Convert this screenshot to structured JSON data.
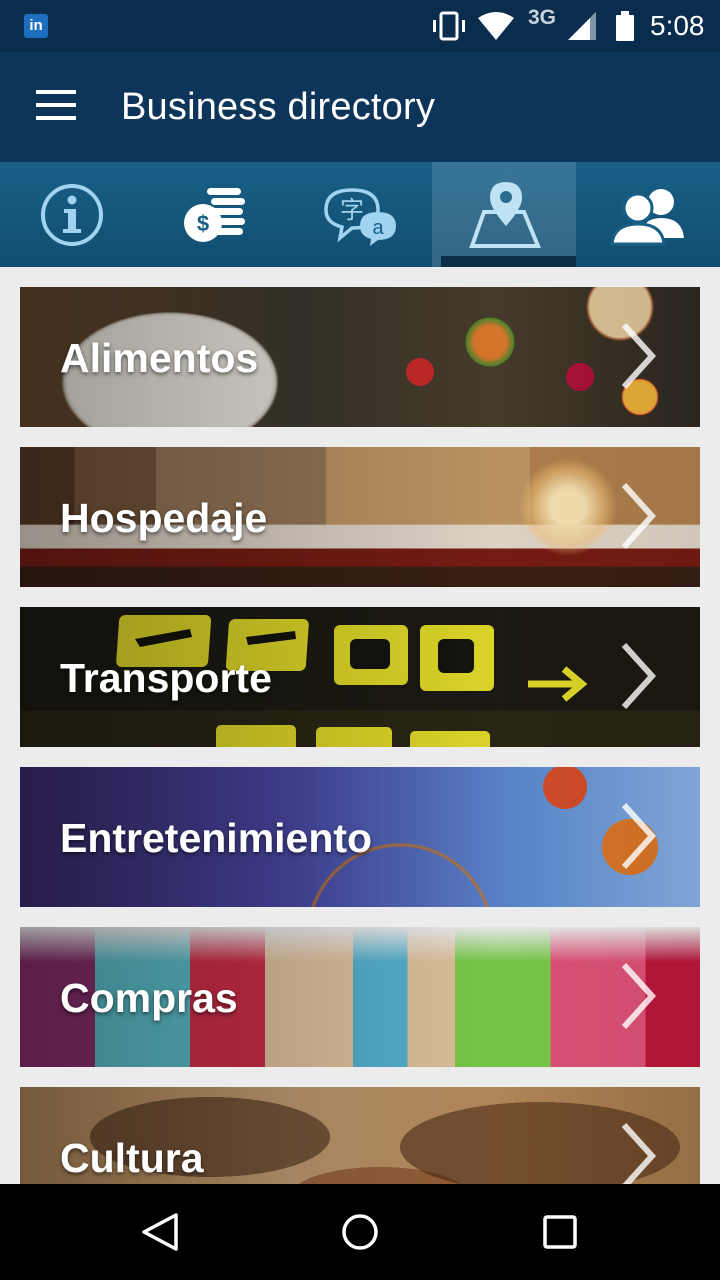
{
  "status_bar": {
    "app_badge": "in",
    "network": "3G",
    "time": "5:08",
    "icons": [
      "linkedin-icon",
      "vibrate-icon",
      "wifi-icon",
      "signal-icon",
      "battery-icon"
    ]
  },
  "app_bar": {
    "title": "Business directory",
    "menu_icon": "hamburger-menu-icon"
  },
  "tabs": [
    {
      "icon": "info-icon",
      "active": false
    },
    {
      "icon": "currency-coins-icon",
      "active": false
    },
    {
      "icon": "translate-icon",
      "active": false
    },
    {
      "icon": "map-pin-icon",
      "active": true
    },
    {
      "icon": "people-icon",
      "active": false
    }
  ],
  "categories": [
    {
      "label": "Alimentos",
      "icon": "chevron-right-icon"
    },
    {
      "label": "Hospedaje",
      "icon": "chevron-right-icon"
    },
    {
      "label": "Transporte",
      "icon": "chevron-right-icon"
    },
    {
      "label": "Entretenimiento",
      "icon": "chevron-right-icon"
    },
    {
      "label": "Compras",
      "icon": "chevron-right-icon"
    },
    {
      "label": "Cultura",
      "icon": "chevron-right-icon"
    }
  ],
  "nav_bar": {
    "back_icon": "back-triangle-icon",
    "home_icon": "home-circle-icon",
    "recents_icon": "recents-square-icon"
  },
  "colors": {
    "status_bar": "#0a2d4d",
    "app_bar": "#0d3559",
    "tab_bar": "#185f86",
    "background": "#ececec"
  }
}
